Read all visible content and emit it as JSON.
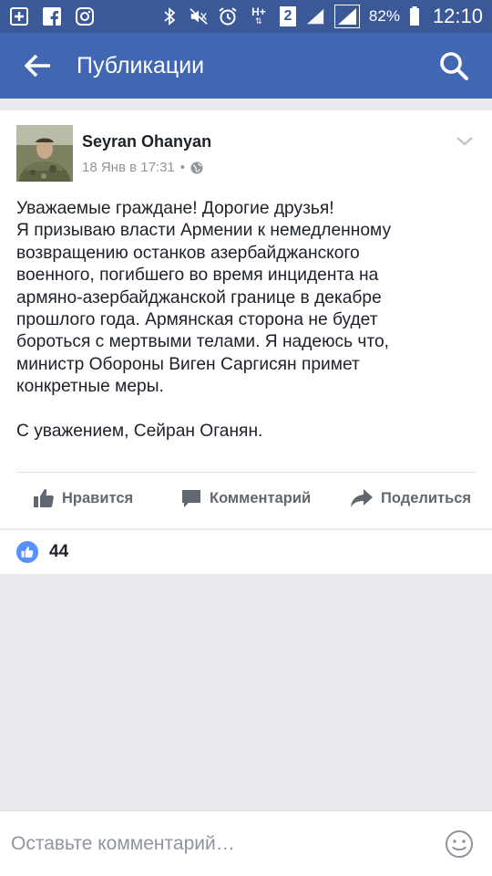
{
  "status_bar": {
    "battery": "82%",
    "time": "12:10",
    "sim_slot": "2",
    "network": "H+",
    "icons": [
      "plus-box-icon",
      "facebook-icon",
      "instagram-icon",
      "bluetooth-icon",
      "mute-icon",
      "alarm-icon",
      "network-h-plus-icon",
      "sim-2-icon",
      "signal-icon",
      "signal-icon",
      "battery-icon"
    ]
  },
  "header": {
    "title": "Публикации",
    "back_icon": "arrow-back-icon",
    "search_icon": "search-icon"
  },
  "post": {
    "author": "Seyran Ohanyan",
    "date": "18 Янв в 17:31",
    "separator": "•",
    "privacy_icon": "globe-icon",
    "menu_icon": "chevron-down-icon",
    "lines": [
      "Уважаемые граждане! Дорогие друзья!",
      "Я призываю власти Армении к немедленному",
      "возвращению останков азербайджанского",
      "военного, погибшего во время инцидента на",
      "армяно-азербайджанской границе в декабре",
      "прошлого года. Армянская сторона не будет",
      "бороться с мертвыми телами. Я надеюсь что,",
      "министр Обороны Виген Саргисян примет",
      "конкретные меры."
    ],
    "signature": "С уважением, Сейран Оганян.",
    "actions": {
      "like": "Нравится",
      "comment": "Комментарий",
      "share": "Поделиться"
    }
  },
  "reactions": {
    "like_count": "44",
    "icon": "like-icon"
  },
  "comment_bar": {
    "placeholder": "Оставьте комментарий…",
    "emoji_icon": "smiley-icon"
  },
  "colors": {
    "status_bar": "#3b5998",
    "app_bar": "#4267b2",
    "like_blue": "#5890ff",
    "background": "#e9ebee"
  }
}
